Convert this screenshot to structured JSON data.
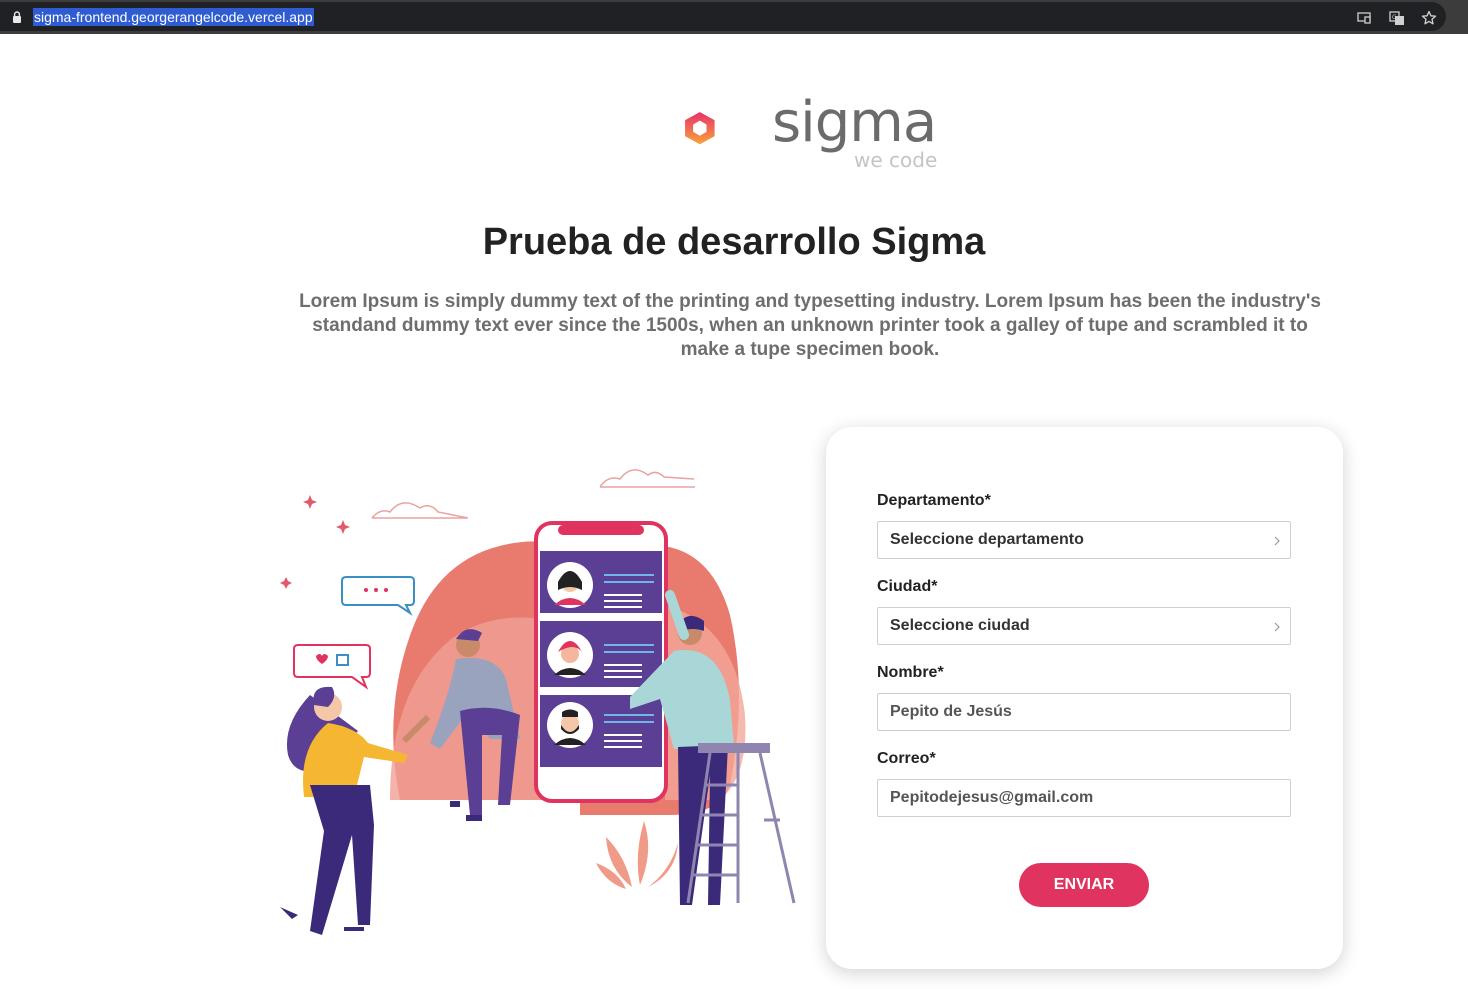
{
  "browser": {
    "url": "sigma-frontend.georgerangelcode.vercel.app"
  },
  "logo": {
    "word": "sigma",
    "tagline": "we code"
  },
  "header": {
    "title": "Prueba de desarrollo Sigma",
    "description": "Lorem Ipsum is simply dummy text of the printing and typesetting industry. Lorem Ipsum has been the industry's standand dummy text ever since the 1500s, when an unknown printer took a galley of tupe and scrambled it to make a tupe specimen book."
  },
  "form": {
    "department": {
      "label": "Departamento*",
      "value": "Seleccione departamento"
    },
    "city": {
      "label": "Ciudad*",
      "value": "Seleccione ciudad"
    },
    "name": {
      "label": "Nombre*",
      "placeholder": "Pepito de Jesús"
    },
    "email": {
      "label": "Correo*",
      "placeholder": "Pepitodejesus@gmail.com"
    },
    "submit_label": "ENVIAR"
  },
  "colors": {
    "accent": "#e0335f",
    "logo_gradient_start": "#e8336b",
    "logo_gradient_end": "#f7a13a",
    "phone_screen": "#5a3f94"
  }
}
